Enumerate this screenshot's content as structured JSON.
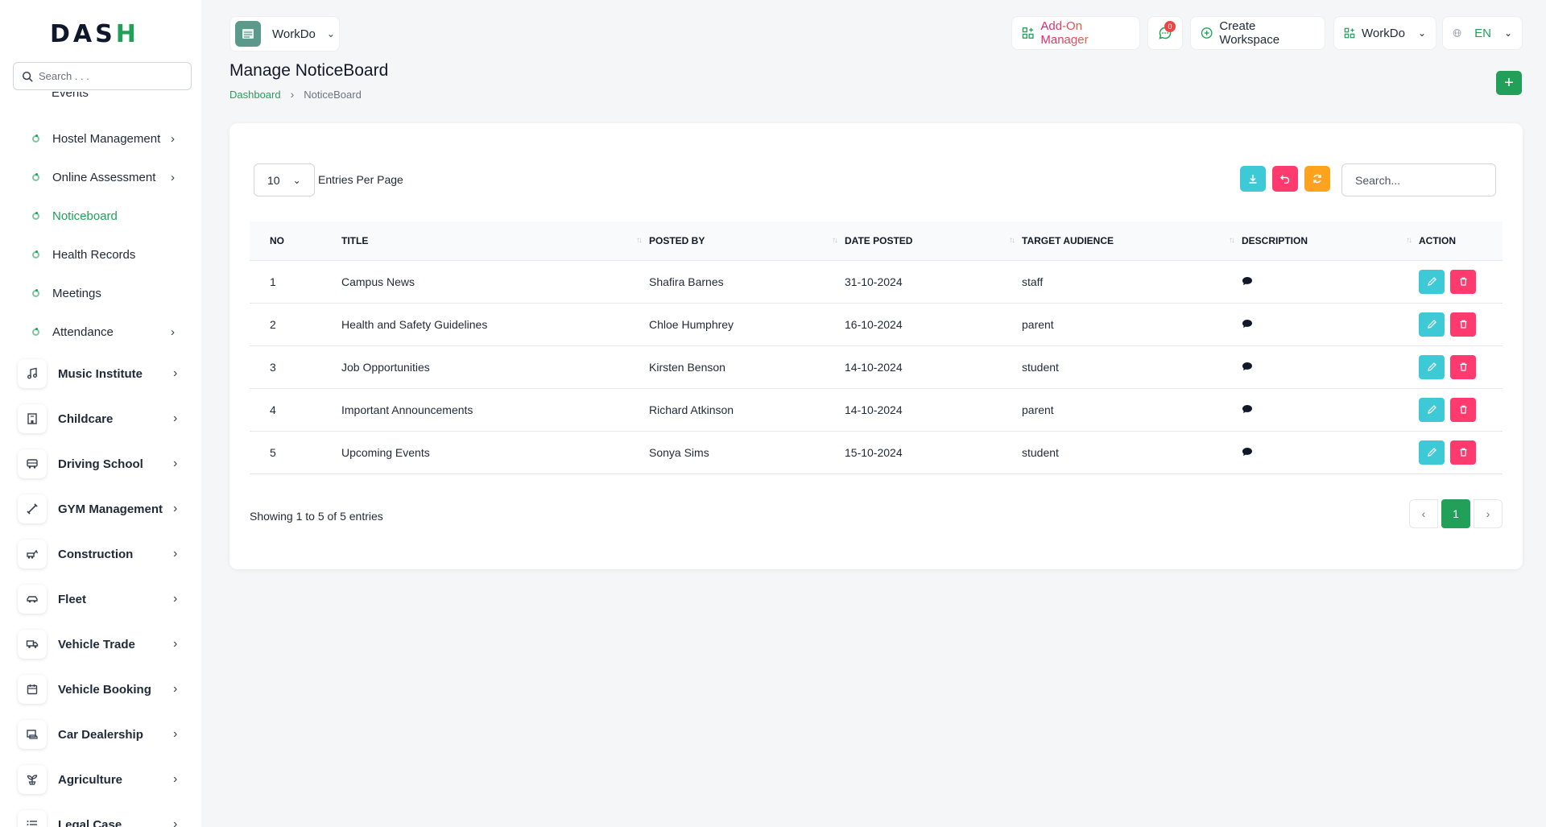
{
  "brand": {
    "logo_text_a": "DAS",
    "logo_text_b": "H"
  },
  "sidebar": {
    "search_placeholder": "Search . . .",
    "partial_item": "Events",
    "sub_items": [
      {
        "label": "Hostel Management",
        "has_children": true
      },
      {
        "label": "Online Assessment",
        "has_children": true
      },
      {
        "label": "Noticeboard",
        "has_children": false,
        "active": true
      },
      {
        "label": "Health Records",
        "has_children": false
      },
      {
        "label": "Meetings",
        "has_children": false
      },
      {
        "label": "Attendance",
        "has_children": true
      }
    ],
    "main_items": [
      {
        "label": "Music Institute",
        "icon": "music-icon"
      },
      {
        "label": "Childcare",
        "icon": "building-icon"
      },
      {
        "label": "Driving School",
        "icon": "bus-icon"
      },
      {
        "label": "GYM Management",
        "icon": "dumbbell-icon"
      },
      {
        "label": "Construction",
        "icon": "excavator-icon"
      },
      {
        "label": "Fleet",
        "icon": "car-icon"
      },
      {
        "label": "Vehicle Trade",
        "icon": "truck-icon"
      },
      {
        "label": "Vehicle Booking",
        "icon": "calendar-icon"
      },
      {
        "label": "Car Dealership",
        "icon": "dealership-icon"
      },
      {
        "label": "Agriculture",
        "icon": "plant-icon"
      },
      {
        "label": "Legal Case",
        "icon": "list-icon"
      }
    ]
  },
  "header": {
    "workspace_name": "WorkDo",
    "addon_label": "Add-On Manager",
    "message_count": "0",
    "create_workspace_label": "Create Workspace",
    "workspace_dropdown_label": "WorkDo",
    "language": "EN"
  },
  "page": {
    "title": "Manage NoticeBoard",
    "breadcrumb": {
      "home": "Dashboard",
      "current": "NoticeBoard"
    }
  },
  "table": {
    "per_page_value": "10",
    "per_page_label": "Entries Per Page",
    "search_placeholder": "Search...",
    "headers": {
      "no": "NO",
      "title": "TITLE",
      "posted_by": "POSTED BY",
      "date_posted": "DATE POSTED",
      "target_audience": "TARGET AUDIENCE",
      "description": "DESCRIPTION",
      "action": "ACTION"
    },
    "rows": [
      {
        "no": "1",
        "title": "Campus News",
        "posted_by": "Shafira Barnes",
        "date_posted": "31-10-2024",
        "target_audience": "staff"
      },
      {
        "no": "2",
        "title": "Health and Safety Guidelines",
        "posted_by": "Chloe Humphrey",
        "date_posted": "16-10-2024",
        "target_audience": "parent"
      },
      {
        "no": "3",
        "title": "Job Opportunities",
        "posted_by": "Kirsten Benson",
        "date_posted": "14-10-2024",
        "target_audience": "student"
      },
      {
        "no": "4",
        "title": "Important Announcements",
        "posted_by": "Richard Atkinson",
        "date_posted": "14-10-2024",
        "target_audience": "parent"
      },
      {
        "no": "5",
        "title": "Upcoming Events",
        "posted_by": "Sonya Sims",
        "date_posted": "15-10-2024",
        "target_audience": "student"
      }
    ],
    "showing_text": "Showing 1 to 5 of 5 entries",
    "current_page": "1"
  },
  "colors": {
    "accent_green": "#22a05a",
    "cyan": "#3ec9d6",
    "pink": "#ff3a6e",
    "orange": "#ffa21d"
  }
}
